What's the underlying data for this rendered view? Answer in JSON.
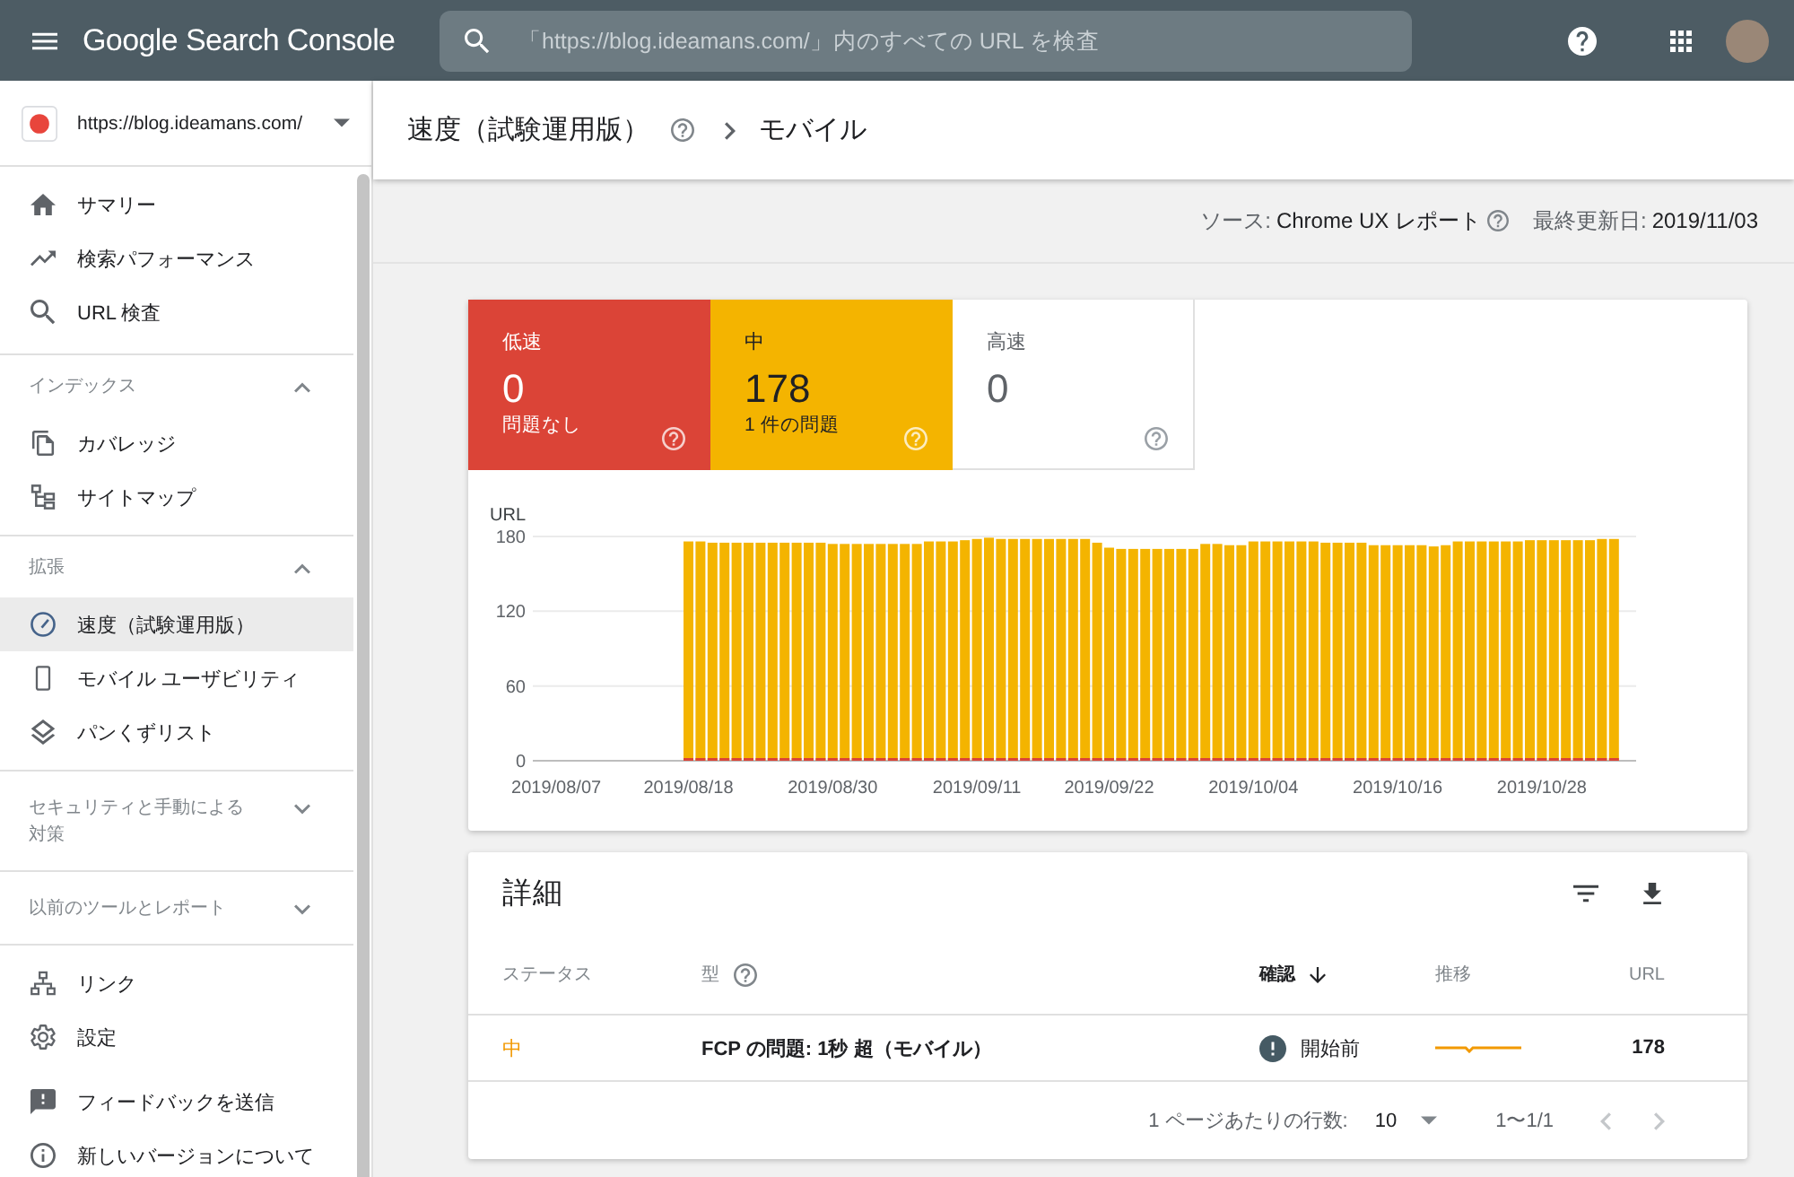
{
  "app_bar": {
    "product_name": "Google Search Console",
    "search": {
      "placeholder": "「https://blog.ideamans.com/」内のすべての URL を検査"
    }
  },
  "sidebar": {
    "property": {
      "url": "https://blog.ideamans.com/"
    },
    "groups": [
      {
        "items": [
          {
            "label": "サマリー",
            "selected": false
          },
          {
            "label": "検索パフォーマンス",
            "selected": false
          },
          {
            "label": "URL 検査",
            "selected": false
          }
        ]
      },
      {
        "title": "インデックス",
        "expanded": true,
        "items": [
          {
            "label": "カバレッジ",
            "selected": false
          },
          {
            "label": "サイトマップ",
            "selected": false
          }
        ]
      },
      {
        "title": "拡張",
        "expanded": true,
        "items": [
          {
            "label": "速度（試験運用版）",
            "selected": true
          },
          {
            "label": "モバイル ユーザビリティ",
            "selected": false
          },
          {
            "label": "パンくずリスト",
            "selected": false
          }
        ]
      },
      {
        "title": "セキュリティと手動による対策",
        "expanded": false
      },
      {
        "title": "以前のツールとレポート",
        "expanded": false
      },
      {
        "items": [
          {
            "label": "リンク",
            "selected": false
          },
          {
            "label": "設定",
            "selected": false
          }
        ]
      },
      {
        "items": [
          {
            "label": "フィードバックを送信",
            "selected": false
          },
          {
            "label": "新しいバージョンについて",
            "selected": false
          }
        ]
      }
    ]
  },
  "header": {
    "breadcrumb": [
      "速度（試験運用版）",
      "モバイル"
    ]
  },
  "source_info": [
    {
      "label": "ソース:",
      "value": "Chrome UX レポート"
    },
    {
      "label": "最終更新日:",
      "value": "2019/11/03"
    }
  ],
  "summary_tiles": [
    {
      "label": "低速",
      "count": "0",
      "note": "問題なし",
      "selected": true,
      "color": "#db4437"
    },
    {
      "label": "中",
      "count": "178",
      "note": "1 件の問題",
      "selected": true,
      "color": "#f4b400"
    },
    {
      "label": "高速",
      "count": "0",
      "selected": false
    }
  ],
  "chart": {
    "chart_data": {
      "type": "bar",
      "ylabel": "URL",
      "categories": [
        null,
        "2019/08/07",
        null,
        null,
        null,
        null,
        null,
        null,
        null,
        null,
        null,
        null,
        "2019/08/18",
        null,
        null,
        null,
        null,
        null,
        null,
        null,
        null,
        null,
        null,
        null,
        "2019/08/30",
        null,
        null,
        null,
        null,
        null,
        null,
        null,
        null,
        null,
        null,
        null,
        "2019/09/11",
        null,
        null,
        null,
        null,
        null,
        null,
        null,
        null,
        null,
        null,
        "2019/09/22",
        null,
        null,
        null,
        null,
        null,
        null,
        null,
        null,
        null,
        null,
        null,
        "2019/10/04",
        null,
        null,
        null,
        null,
        null,
        null,
        null,
        null,
        null,
        null,
        null,
        "2019/10/16",
        null,
        null,
        null,
        null,
        null,
        null,
        null,
        null,
        null,
        null,
        null,
        "2019/10/28",
        null,
        null,
        null,
        null,
        null,
        null
      ],
      "series": [
        {
          "color": "#f4b400",
          "values": [
            null,
            null,
            null,
            null,
            null,
            null,
            null,
            null,
            null,
            null,
            null,
            null,
            176,
            176,
            175,
            175,
            175,
            175,
            175,
            175,
            175,
            175,
            175,
            175,
            174,
            174,
            174,
            174,
            174,
            174,
            174,
            174,
            176,
            176,
            176,
            177,
            178,
            179,
            178,
            178,
            178,
            178,
            178,
            178,
            178,
            178,
            175,
            171,
            170,
            170,
            170,
            170,
            170,
            170,
            170,
            174,
            174,
            173,
            173,
            176,
            176,
            176,
            176,
            176,
            176,
            175,
            175,
            175,
            175,
            173,
            173,
            173,
            173,
            173,
            172,
            173,
            176,
            176,
            176,
            176,
            176,
            176,
            177,
            177,
            177,
            177,
            177,
            177,
            178,
            178
          ]
        },
        {
          "color": "#db4437",
          "values": [
            null,
            null,
            null,
            null,
            null,
            null,
            null,
            null,
            null,
            null,
            null,
            null,
            0,
            0,
            0,
            0,
            0,
            0,
            0,
            0,
            0,
            0,
            0,
            0,
            0,
            0,
            0,
            0,
            0,
            0,
            0,
            0,
            0,
            0,
            0,
            0,
            0,
            0,
            0,
            0,
            0,
            0,
            0,
            0,
            0,
            0,
            0,
            0,
            0,
            0,
            0,
            0,
            0,
            0,
            0,
            0,
            0,
            0,
            0,
            0,
            0,
            0,
            0,
            0,
            0,
            0,
            0,
            0,
            0,
            0,
            0,
            0,
            0,
            0,
            0,
            0,
            0,
            0,
            0,
            0,
            0,
            0,
            0,
            0,
            0,
            0,
            0,
            0,
            0,
            0
          ]
        }
      ],
      "ylim": [
        0,
        180
      ],
      "yticks": [
        0,
        60,
        120,
        180
      ]
    }
  },
  "details": {
    "title": "詳細",
    "columns": [
      {
        "label": "ステータス",
        "sorted": false
      },
      {
        "label": "型",
        "sorted": false
      },
      {
        "label": "確認",
        "sorted": true
      },
      {
        "label": "推移",
        "sorted": false
      },
      {
        "label": "URL",
        "sorted": false
      }
    ],
    "rows": [
      {
        "status": "中",
        "color": "#f29900",
        "type": "FCP の問題: 1秒 超（モバイル）",
        "validation": "開始前",
        "urls": "178"
      }
    ],
    "pagination": {
      "rows_per_page_label": "1 ページあたりの行数:",
      "rows_per_page": "10",
      "range": "1〜1/1",
      "prev_disabled": true,
      "next_disabled": true
    }
  }
}
